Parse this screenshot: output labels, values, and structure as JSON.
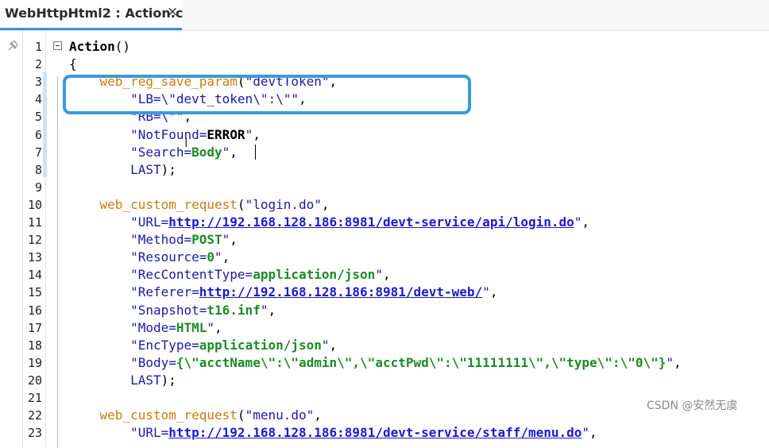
{
  "tab": {
    "title": "WebHttpHtml2 : Action.c",
    "close": "×"
  },
  "lines": [
    {
      "n": "1",
      "segs": [
        {
          "t": "Action",
          "c": "def"
        },
        {
          "t": "()",
          "c": "plain"
        }
      ]
    },
    {
      "n": "2",
      "segs": [
        {
          "t": "{",
          "c": "plain"
        }
      ]
    },
    {
      "n": "3",
      "segs": [
        {
          "t": "    ",
          "c": "plain"
        },
        {
          "t": "web_reg_save_param",
          "c": "fn"
        },
        {
          "t": "(",
          "c": "plain"
        },
        {
          "t": "\"devtToken\"",
          "c": "str"
        },
        {
          "t": ",",
          "c": "plain"
        }
      ]
    },
    {
      "n": "4",
      "segs": [
        {
          "t": "        ",
          "c": "plain"
        },
        {
          "t": "\"LB=\\\"devt_token\\\":\\\"\"",
          "c": "str"
        },
        {
          "t": ",",
          "c": "plain"
        }
      ]
    },
    {
      "n": "5",
      "segs": [
        {
          "t": "        ",
          "c": "plain"
        },
        {
          "t": "\"RB=\\\"\"",
          "c": "str"
        },
        {
          "t": ",",
          "c": "plain"
        }
      ]
    },
    {
      "n": "6",
      "segs": [
        {
          "t": "        ",
          "c": "plain"
        },
        {
          "t": "\"NotFound=",
          "c": "str"
        },
        {
          "t": "ERROR",
          "c": "def"
        },
        {
          "t": "\"",
          "c": "str"
        },
        {
          "t": ",",
          "c": "plain"
        }
      ]
    },
    {
      "n": "7",
      "segs": [
        {
          "t": "        ",
          "c": "plain"
        },
        {
          "t": "\"Search=",
          "c": "str"
        },
        {
          "t": "Body",
          "c": "kw"
        },
        {
          "t": "\"",
          "c": "str"
        },
        {
          "t": ",",
          "c": "plain"
        }
      ]
    },
    {
      "n": "8",
      "segs": [
        {
          "t": "        ",
          "c": "plain"
        },
        {
          "t": "LAST",
          "c": "str"
        },
        {
          "t": ");",
          "c": "plain"
        }
      ]
    },
    {
      "n": "9",
      "segs": []
    },
    {
      "n": "10",
      "segs": [
        {
          "t": "    ",
          "c": "plain"
        },
        {
          "t": "web_custom_request",
          "c": "fn"
        },
        {
          "t": "(",
          "c": "plain"
        },
        {
          "t": "\"login.do\"",
          "c": "str"
        },
        {
          "t": ",",
          "c": "plain"
        }
      ]
    },
    {
      "n": "11",
      "segs": [
        {
          "t": "        ",
          "c": "plain"
        },
        {
          "t": "\"URL=",
          "c": "str"
        },
        {
          "t": "http://192.168.128.186:8981/devt-service/api/login.do",
          "c": "url"
        },
        {
          "t": "\"",
          "c": "str"
        },
        {
          "t": ",",
          "c": "plain"
        }
      ]
    },
    {
      "n": "12",
      "segs": [
        {
          "t": "        ",
          "c": "plain"
        },
        {
          "t": "\"Method=",
          "c": "str"
        },
        {
          "t": "POST",
          "c": "kw"
        },
        {
          "t": "\"",
          "c": "str"
        },
        {
          "t": ",",
          "c": "plain"
        }
      ]
    },
    {
      "n": "13",
      "segs": [
        {
          "t": "        ",
          "c": "plain"
        },
        {
          "t": "\"Resource=",
          "c": "str"
        },
        {
          "t": "0",
          "c": "kw"
        },
        {
          "t": "\"",
          "c": "str"
        },
        {
          "t": ",",
          "c": "plain"
        }
      ]
    },
    {
      "n": "14",
      "segs": [
        {
          "t": "        ",
          "c": "plain"
        },
        {
          "t": "\"RecContentType=",
          "c": "str"
        },
        {
          "t": "application/json",
          "c": "kw"
        },
        {
          "t": "\"",
          "c": "str"
        },
        {
          "t": ",",
          "c": "plain"
        }
      ]
    },
    {
      "n": "15",
      "segs": [
        {
          "t": "        ",
          "c": "plain"
        },
        {
          "t": "\"Referer=",
          "c": "str"
        },
        {
          "t": "http://192.168.128.186:8981/devt-web/",
          "c": "url"
        },
        {
          "t": "\"",
          "c": "str"
        },
        {
          "t": ",",
          "c": "plain"
        }
      ]
    },
    {
      "n": "16",
      "segs": [
        {
          "t": "        ",
          "c": "plain"
        },
        {
          "t": "\"Snapshot=",
          "c": "str"
        },
        {
          "t": "t16.inf",
          "c": "kw"
        },
        {
          "t": "\"",
          "c": "str"
        },
        {
          "t": ",",
          "c": "plain"
        }
      ]
    },
    {
      "n": "17",
      "segs": [
        {
          "t": "        ",
          "c": "plain"
        },
        {
          "t": "\"Mode=",
          "c": "str"
        },
        {
          "t": "HTML",
          "c": "kw"
        },
        {
          "t": "\"",
          "c": "str"
        },
        {
          "t": ",",
          "c": "plain"
        }
      ]
    },
    {
      "n": "18",
      "segs": [
        {
          "t": "        ",
          "c": "plain"
        },
        {
          "t": "\"EncType=",
          "c": "str"
        },
        {
          "t": "application/json",
          "c": "kw"
        },
        {
          "t": "\"",
          "c": "str"
        },
        {
          "t": ",",
          "c": "plain"
        }
      ]
    },
    {
      "n": "19",
      "segs": [
        {
          "t": "        ",
          "c": "plain"
        },
        {
          "t": "\"Body=",
          "c": "str"
        },
        {
          "t": "{\\\"acctName\\\":\\\"admin\\\",\\\"acctPwd\\\":\\\"11111111\\\",\\\"type\\\":\\\"0\\\"}",
          "c": "kw"
        },
        {
          "t": "\"",
          "c": "str"
        },
        {
          "t": ",",
          "c": "plain"
        }
      ]
    },
    {
      "n": "20",
      "segs": [
        {
          "t": "        ",
          "c": "plain"
        },
        {
          "t": "LAST",
          "c": "str"
        },
        {
          "t": ");",
          "c": "plain"
        }
      ]
    },
    {
      "n": "21",
      "segs": []
    },
    {
      "n": "22",
      "segs": [
        {
          "t": "    ",
          "c": "plain"
        },
        {
          "t": "web_custom_request",
          "c": "fn"
        },
        {
          "t": "(",
          "c": "plain"
        },
        {
          "t": "\"menu.do\"",
          "c": "str"
        },
        {
          "t": ",",
          "c": "plain"
        }
      ]
    },
    {
      "n": "23",
      "segs": [
        {
          "t": "        ",
          "c": "plain"
        },
        {
          "t": "\"URL=",
          "c": "str"
        },
        {
          "t": "http://192.168.128.186:8981/devt-service/staff/menu.do",
          "c": "url"
        },
        {
          "t": "\"",
          "c": "str"
        },
        {
          "t": ",",
          "c": "plain"
        }
      ]
    }
  ],
  "cursor_glyph": "I",
  "watermark": "CSDN @安然无虞",
  "colors": {
    "accent": "#3b9ad9",
    "function": "#c87d10",
    "string": "#1a1aa6",
    "keyword": "#1e8a26",
    "link": "#1a1acc"
  },
  "icons": {
    "gutter": "pin-icon",
    "fold": "fold-toggle-icon",
    "close": "close-icon"
  }
}
